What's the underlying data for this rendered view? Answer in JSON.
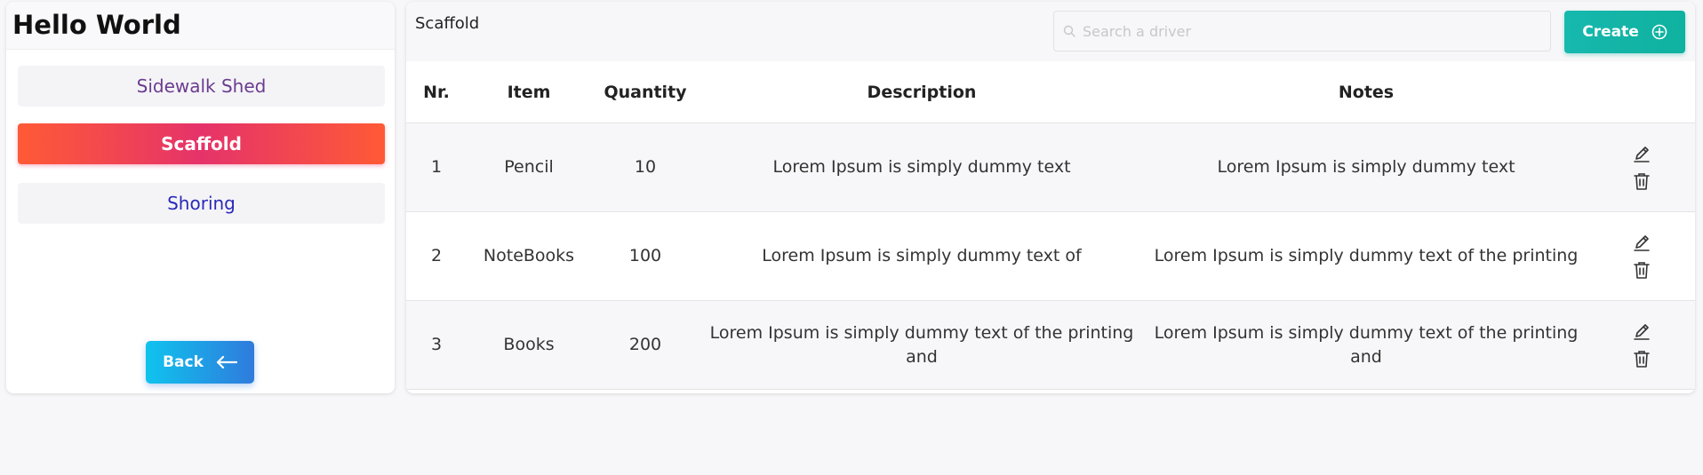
{
  "sidebar": {
    "title": "Hello World",
    "items": [
      {
        "label": "Sidewalk Shed"
      },
      {
        "label": "Scaffold"
      },
      {
        "label": "Shoring"
      }
    ],
    "back_label": "Back"
  },
  "main": {
    "title": "Scaffold",
    "search_placeholder": "Search a driver",
    "create_label": "Create",
    "columns": [
      "Nr.",
      "Item",
      "Quantity",
      "Description",
      "Notes"
    ],
    "rows": [
      {
        "nr": "1",
        "item": "Pencil",
        "quantity": "10",
        "description": "Lorem Ipsum is simply dummy text",
        "notes": "Lorem Ipsum is simply dummy text"
      },
      {
        "nr": "2",
        "item": "NoteBooks",
        "quantity": "100",
        "description": "Lorem Ipsum is simply dummy text of",
        "notes": "Lorem Ipsum is simply dummy text of the printing"
      },
      {
        "nr": "3",
        "item": "Books",
        "quantity": "200",
        "description": "Lorem Ipsum is simply dummy text of the printing and",
        "notes": "Lorem Ipsum is simply dummy text of the printing and"
      }
    ]
  },
  "colors": {
    "active_gradient_start": "#ff5a36",
    "active_gradient_mid": "#e5336a",
    "back_gradient_start": "#0fc3ee",
    "back_gradient_end": "#2f7bdc",
    "create_color": "#17b8ae"
  },
  "icons": {
    "search": "search-icon",
    "create": "plus-circle-icon",
    "back": "arrow-left-icon",
    "edit": "pencil-icon",
    "delete": "trash-icon"
  }
}
